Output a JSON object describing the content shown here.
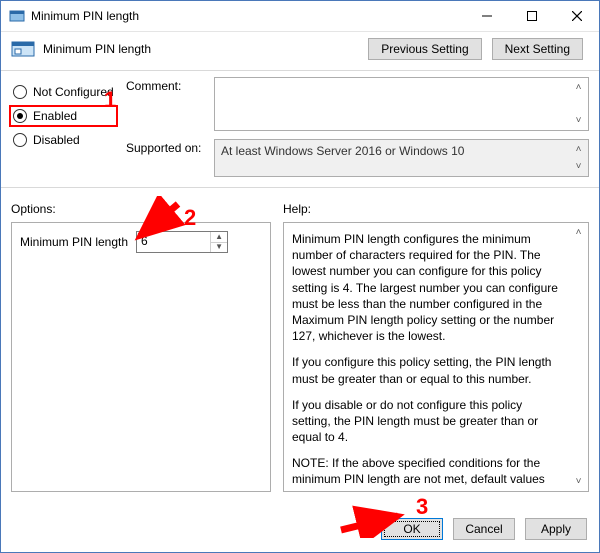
{
  "window": {
    "title": "Minimum PIN length"
  },
  "header": {
    "policy_title": "Minimum PIN length",
    "prev": "Previous Setting",
    "next": "Next Setting"
  },
  "state": {
    "not_configured": "Not Configured",
    "enabled": "Enabled",
    "disabled": "Disabled",
    "selected": "enabled"
  },
  "fields": {
    "comment_label": "Comment:",
    "comment_value": "",
    "supported_label": "Supported on:",
    "supported_value": "At least Windows Server 2016 or Windows 10"
  },
  "sections": {
    "options": "Options:",
    "help": "Help:"
  },
  "options": {
    "pin_label": "Minimum PIN length",
    "pin_value": "6"
  },
  "help": {
    "p1": "Minimum PIN length configures the minimum number of characters required for the PIN.  The lowest number you can configure for this policy setting is 4.  The largest number you can configure must be less than the number configured in the Maximum PIN length policy setting or the number 127, whichever is the lowest.",
    "p2": "If you configure this policy setting, the PIN length must be greater than or equal to this number.",
    "p3": "If you disable or do not configure this policy setting, the PIN length must be greater than or equal to 4.",
    "p4": "NOTE: If the above specified conditions for the minimum PIN length are not met, default values will be used for both the maximum and minimum PIN lengths."
  },
  "buttons": {
    "ok": "OK",
    "cancel": "Cancel",
    "apply": "Apply"
  },
  "annotations": {
    "n1": "1",
    "n2": "2",
    "n3": "3"
  }
}
